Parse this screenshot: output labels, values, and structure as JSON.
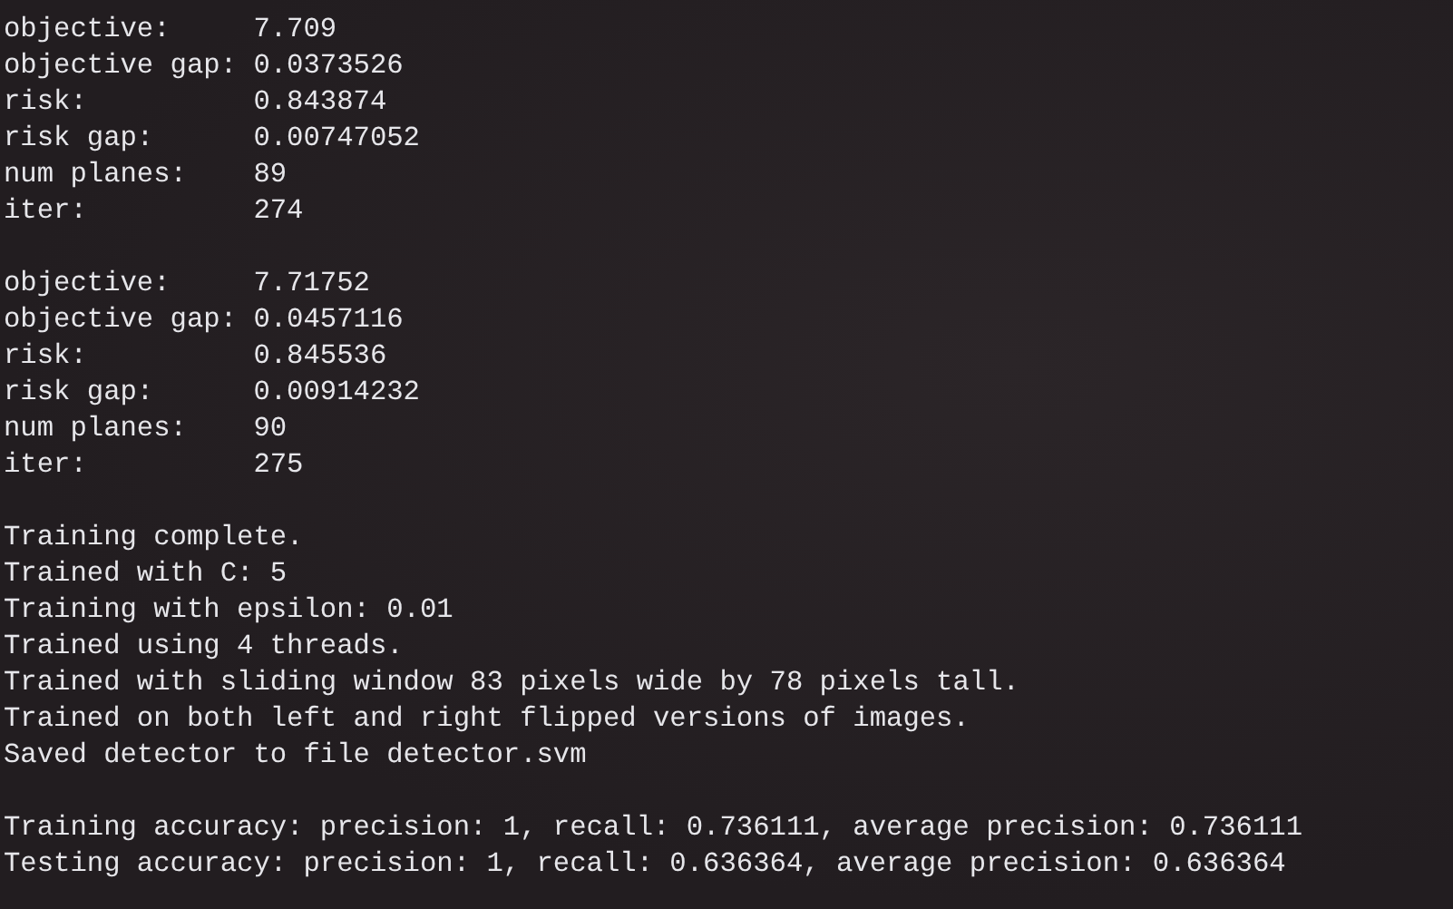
{
  "iterations": [
    {
      "fields": [
        {
          "label": "objective:",
          "value": "7.709"
        },
        {
          "label": "objective gap:",
          "value": "0.0373526"
        },
        {
          "label": "risk:",
          "value": "0.843874"
        },
        {
          "label": "risk gap:",
          "value": "0.00747052"
        },
        {
          "label": "num planes:",
          "value": "89"
        },
        {
          "label": "iter:",
          "value": "274"
        }
      ]
    },
    {
      "fields": [
        {
          "label": "objective:",
          "value": "7.71752"
        },
        {
          "label": "objective gap:",
          "value": "0.0457116"
        },
        {
          "label": "risk:",
          "value": "0.845536"
        },
        {
          "label": "risk gap:",
          "value": "0.00914232"
        },
        {
          "label": "num planes:",
          "value": "90"
        },
        {
          "label": "iter:",
          "value": "275"
        }
      ]
    }
  ],
  "summary": [
    "Training complete.",
    "Trained with C: 5",
    "Training with epsilon: 0.01",
    "Trained using 4 threads.",
    "Trained with sliding window 83 pixels wide by 78 pixels tall.",
    "Trained on both left and right flipped versions of images.",
    "Saved detector to file detector.svm"
  ],
  "accuracy": [
    "Training accuracy: precision: 1, recall: 0.736111, average precision: 0.736111",
    "Testing accuracy: precision: 1, recall: 0.636364, average precision: 0.636364"
  ]
}
